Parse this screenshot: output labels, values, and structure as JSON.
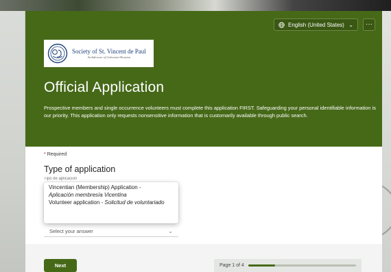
{
  "header": {
    "language_label": "English (United States)",
    "more_label": "···",
    "logo": {
      "name": "Society of St. Vincent de Paul",
      "subtitle": "Archdiocese of Galveston-Houston"
    },
    "title": "Official Application",
    "description": "Prospective members and single occurrence volunteers must complete this application FIRST. Safeguarding your personal identifiable information is our priority. This application only requests nonsensitive information that is customarily available through public search."
  },
  "form": {
    "required_star": "*",
    "required_label": "Required",
    "question_title": "Type of application",
    "question_subtitle": "Tipo de aplicacion",
    "options": [
      {
        "en": "Vincentian (Membership) Application -",
        "es": "Aplicación membresía Vicentina"
      },
      {
        "en": "Volunteer application -",
        "es": "Solicitud de voluntariado"
      }
    ],
    "select_placeholder": "Select your answer"
  },
  "footer": {
    "next_label": "Next",
    "page_label": "Page 1 of 4",
    "progress": 0.25
  },
  "colors": {
    "brand_green": "#466918",
    "required_red": "#b3261e"
  },
  "icons": [
    "globe-icon",
    "chevron-down-icon",
    "more-icon",
    "logo-emblem"
  ]
}
